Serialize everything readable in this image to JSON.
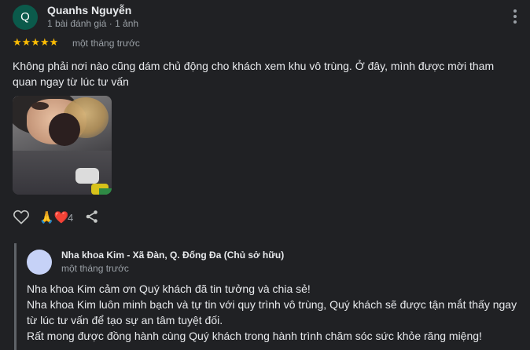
{
  "review": {
    "avatar_letter": "Q",
    "reviewer_name": "Quanhs Nguyễn",
    "reviewer_meta": "1 bài đánh giá · 1 ảnh",
    "rating": 5,
    "stars": "★★★★★",
    "time": "một tháng trước",
    "text": "Không phải nơi nào cũng dám chủ động cho khách xem khu vô trùng. Ở đây, mình được mời tham quan ngay từ lúc tư vấn",
    "reactions": "🙏❤️",
    "reaction_count": "4"
  },
  "owner_reply": {
    "name": "Nha khoa Kim - Xã Đàn, Q. Đống Đa (Chủ sở hữu)",
    "time": "một tháng trước",
    "lines": [
      "Nha khoa Kim cảm ơn Quý khách đã tin tưởng và chia sẻ!",
      "Nha khoa Kim luôn minh bạch và tự tin với quy trình vô trùng, Quý khách sẽ được tận mắt thấy ngay",
      "từ lúc tư vấn để tạo sự an tâm tuyệt đối.",
      "Rất mong được đồng hành cùng Quý khách trong hành trình chăm sóc sức khỏe răng miệng!"
    ]
  },
  "colors": {
    "background": "#202124",
    "star": "#fbbc04",
    "avatar": "#0b5a4b",
    "owner_avatar": "#c6d2f7"
  },
  "icons": [
    "more-vert-icon",
    "heart-outline-icon",
    "share-icon"
  ]
}
